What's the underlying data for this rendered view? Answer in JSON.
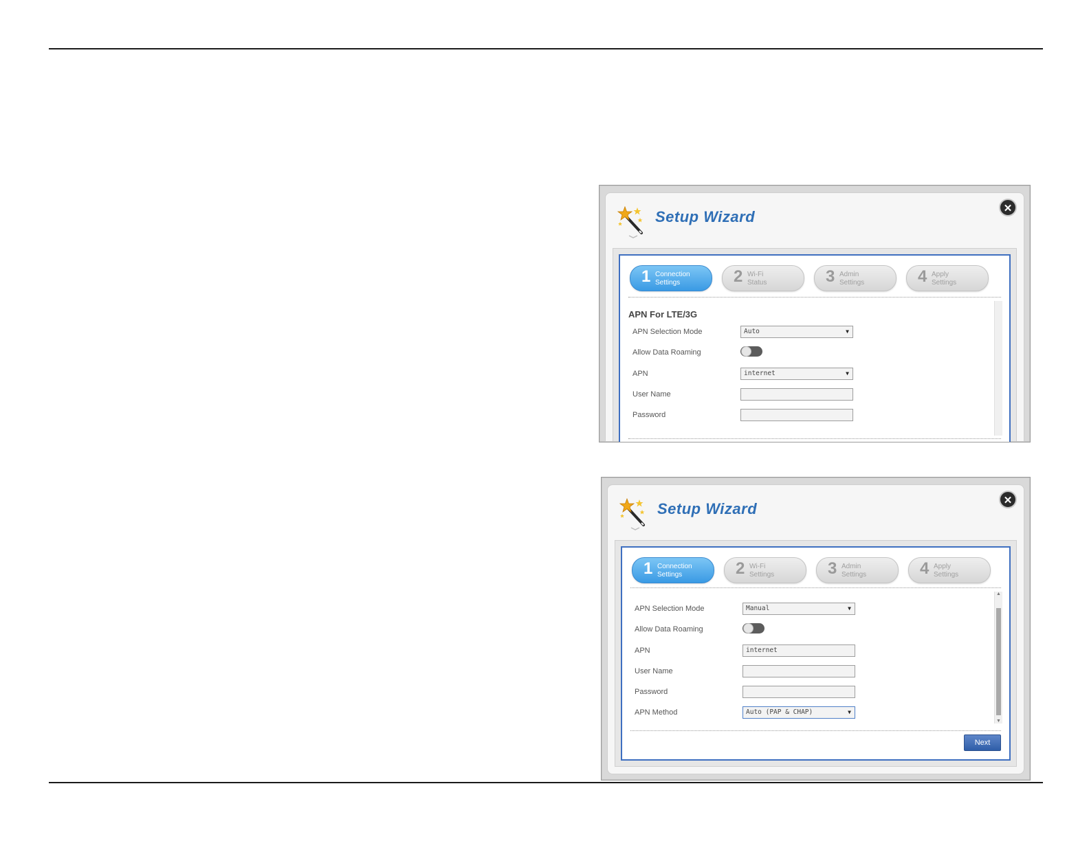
{
  "wizard_title": "Setup Wizard",
  "close_glyph": "✕",
  "icons": {
    "wand": "magic-wand-icon",
    "close": "close-icon"
  },
  "colors": {
    "title": "#2f6fb6",
    "frame_border": "#3e6fc0",
    "active_step": "#3a9ae4"
  },
  "screenshot1": {
    "steps": [
      {
        "num": "1",
        "line1": "Connection",
        "line2": "Settings",
        "active": true
      },
      {
        "num": "2",
        "line1": "Wi-Fi",
        "line2": "Status",
        "active": false
      },
      {
        "num": "3",
        "line1": "Admin",
        "line2": "Settings",
        "active": false
      },
      {
        "num": "4",
        "line1": "Apply",
        "line2": "Settings",
        "active": false
      }
    ],
    "section_title": "APN For LTE/3G",
    "apn_selection_mode": {
      "label": "APN Selection Mode",
      "value": "Auto"
    },
    "allow_data_roaming": {
      "label": "Allow Data Roaming",
      "state": "off"
    },
    "apn": {
      "label": "APN",
      "value": "internet"
    },
    "user_name": {
      "label": "User Name",
      "value": ""
    },
    "password": {
      "label": "Password",
      "value": ""
    }
  },
  "screenshot2": {
    "steps": [
      {
        "num": "1",
        "line1": "Connection",
        "line2": "Settings",
        "active": true
      },
      {
        "num": "2",
        "line1": "Wi-Fi",
        "line2": "Settings",
        "active": false
      },
      {
        "num": "3",
        "line1": "Admin",
        "line2": "Settings",
        "active": false
      },
      {
        "num": "4",
        "line1": "Apply",
        "line2": "Settings",
        "active": false
      }
    ],
    "apn_selection_mode": {
      "label": "APN Selection Mode",
      "value": "Manual"
    },
    "allow_data_roaming": {
      "label": "Allow Data Roaming",
      "state": "off"
    },
    "apn": {
      "label": "APN",
      "value": "internet"
    },
    "user_name": {
      "label": "User Name",
      "value": ""
    },
    "password": {
      "label": "Password",
      "value": ""
    },
    "apn_method": {
      "label": "APN Method",
      "value": "Auto (PAP & CHAP)"
    },
    "next_label": "Next"
  }
}
